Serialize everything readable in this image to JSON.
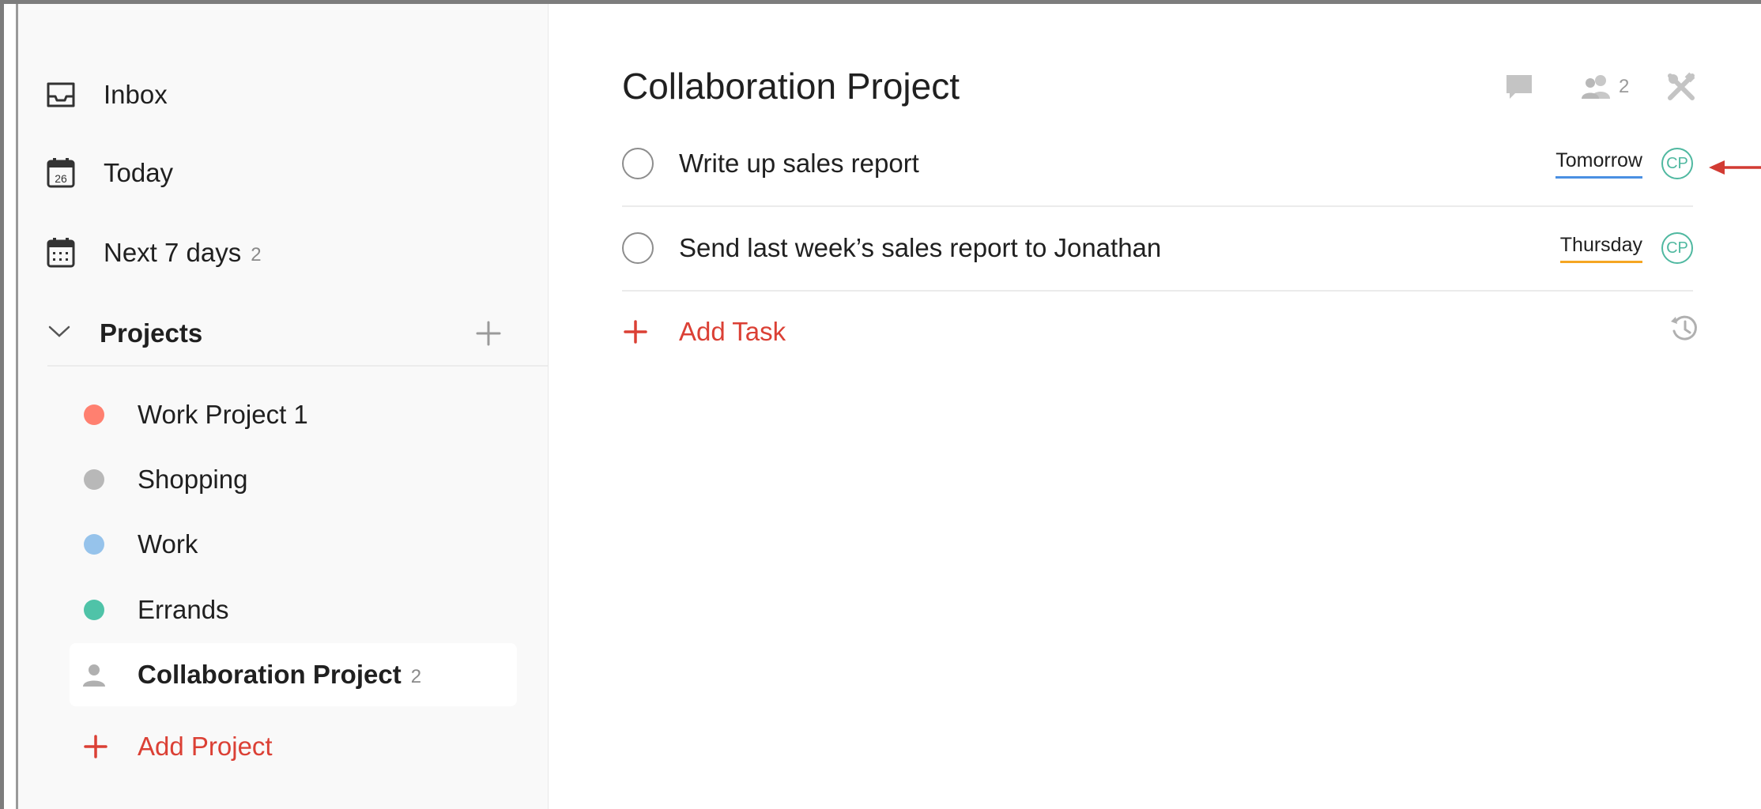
{
  "sidebar": {
    "nav": [
      {
        "label": "Inbox",
        "count": "",
        "icon": "inbox-icon"
      },
      {
        "label": "Today",
        "count": "",
        "icon": "calendar-today-icon",
        "icon_text": "26"
      },
      {
        "label": "Next 7 days",
        "count": "2",
        "icon": "calendar-week-icon"
      }
    ],
    "projects_title": "Projects",
    "projects": [
      {
        "label": "Work Project 1",
        "color": "#ff8070",
        "count": ""
      },
      {
        "label": "Shopping",
        "color": "#b8b8b8",
        "count": ""
      },
      {
        "label": "Work",
        "color": "#96c3eb",
        "count": ""
      },
      {
        "label": "Errands",
        "color": "#4fc3a8",
        "count": ""
      },
      {
        "label": "Collaboration Project",
        "color": "#b0b0b0",
        "count": "2",
        "active": true,
        "icon": "shared-person-icon"
      }
    ],
    "add_project_label": "Add Project"
  },
  "main": {
    "title": "Collaboration Project",
    "header_icons": {
      "comments": "comment-icon",
      "members": "people-icon",
      "members_count": "2",
      "settings": "settings-icon"
    },
    "tasks": [
      {
        "text": "Write up sales report",
        "due": "Tomorrow",
        "due_color": "#4a90e2",
        "assignee": "CP"
      },
      {
        "text": "Send last week’s sales report to Jonathan",
        "due": "Thursday",
        "due_color": "#f5a623",
        "assignee": "CP"
      }
    ],
    "add_task_label": "Add Task"
  },
  "colors": {
    "accent": "#db4035",
    "avatar": "#4fb8a0"
  }
}
